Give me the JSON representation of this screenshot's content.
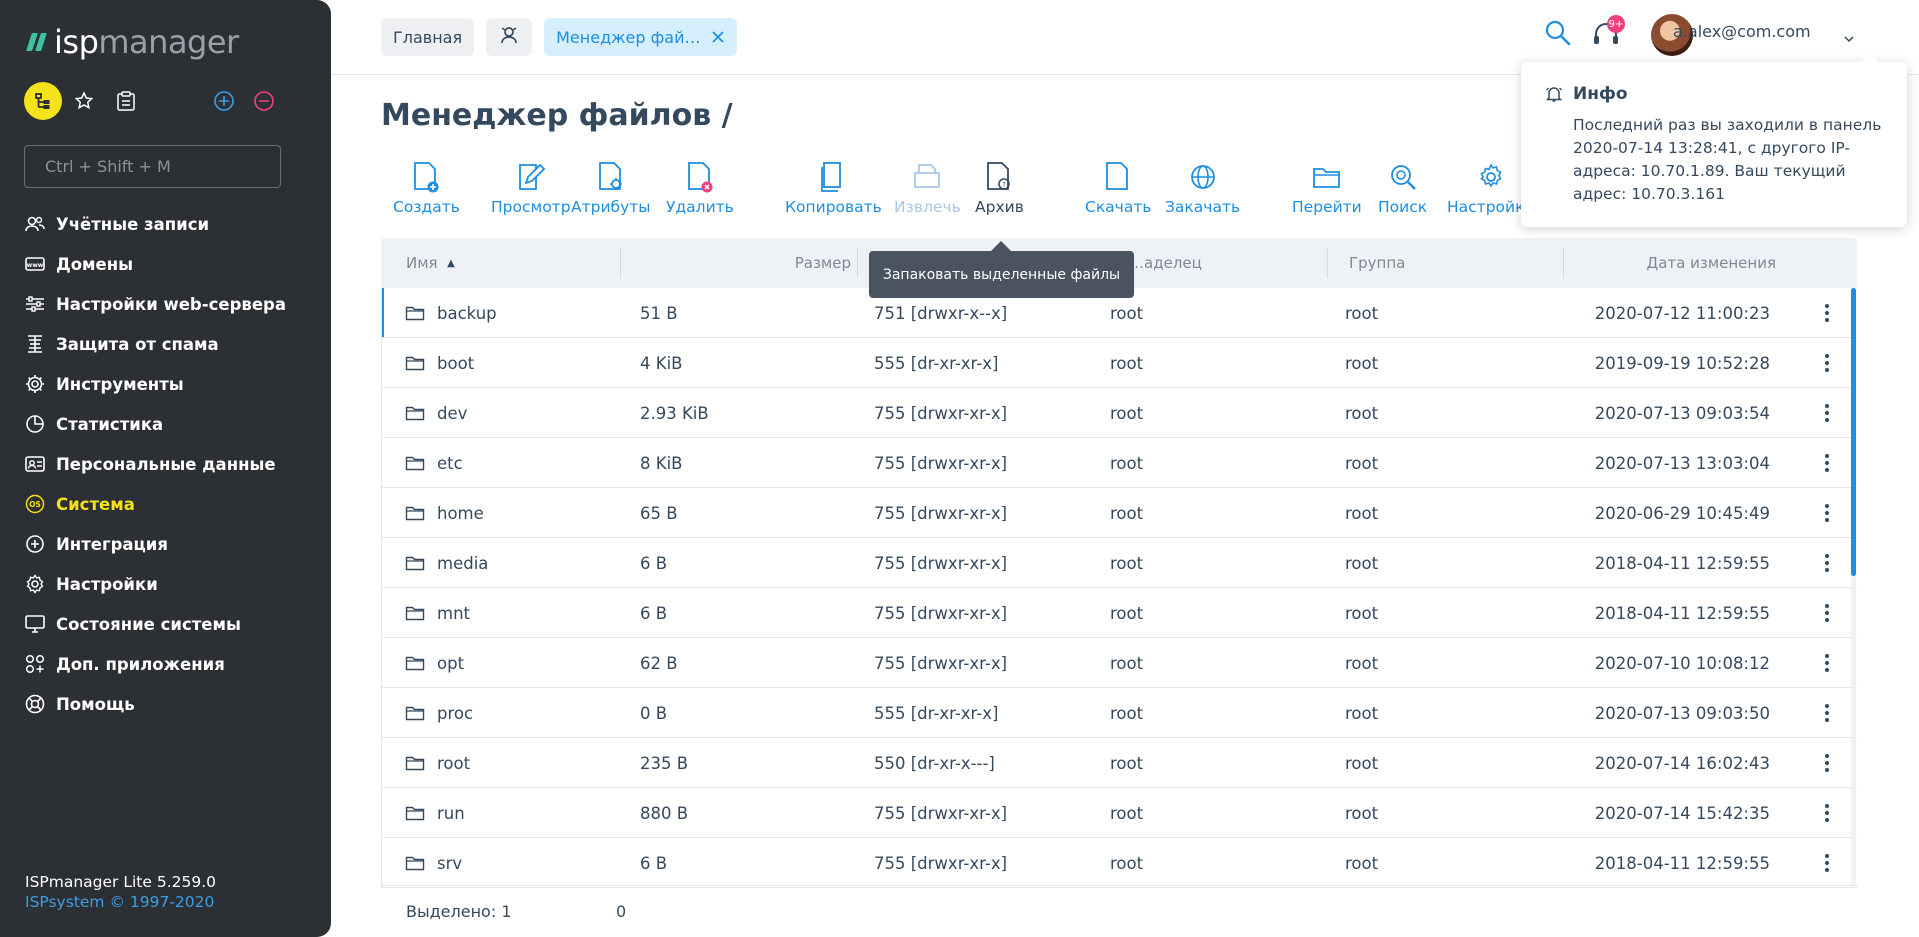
{
  "sidebar": {
    "logo_a": "isp",
    "logo_b": "manager",
    "search_placeholder": "Ctrl + Shift + M",
    "items": [
      {
        "label": "Учётные записи",
        "icon": "users-icon"
      },
      {
        "label": "Домены",
        "icon": "domains-icon"
      },
      {
        "label": "Настройки web-сервера",
        "icon": "sliders-icon"
      },
      {
        "label": "Защита от спама",
        "icon": "spam-shield-icon"
      },
      {
        "label": "Инструменты",
        "icon": "gear-icon"
      },
      {
        "label": "Статистика",
        "icon": "pie-chart-icon"
      },
      {
        "label": "Персональные данные",
        "icon": "personal-data-icon"
      },
      {
        "label": "Система",
        "icon": "os-icon"
      },
      {
        "label": "Интеграция",
        "icon": "integration-icon"
      },
      {
        "label": "Настройки",
        "icon": "settings-icon"
      },
      {
        "label": "Состояние системы",
        "icon": "monitor-icon"
      },
      {
        "label": "Доп. приложения",
        "icon": "apps-icon"
      },
      {
        "label": "Помощь",
        "icon": "lifebuoy-icon"
      }
    ],
    "active_index": 7,
    "version": "ISPmanager Lite 5.259.0",
    "copyright": "ISPsystem © 1997-2020"
  },
  "header": {
    "crumbs": [
      {
        "label": "Главная"
      },
      {
        "label": ""
      },
      {
        "label": "Менеджер фай…"
      }
    ],
    "notifications_badge": "9+",
    "user": "a.alex@com.com"
  },
  "page": {
    "title": "Менеджер файлов /"
  },
  "toolbar": [
    {
      "label": "Создать",
      "icon": "file-add-icon"
    },
    {
      "label": "Просмотр",
      "icon": "file-edit-icon"
    },
    {
      "label": "Атрибуты",
      "icon": "file-attributes-icon"
    },
    {
      "label": "Удалить",
      "icon": "file-delete-icon"
    },
    {
      "label": "Копировать",
      "icon": "copy-icon"
    },
    {
      "label": "Извлечь",
      "icon": "extract-icon"
    },
    {
      "label": "Архив",
      "icon": "archive-icon"
    },
    {
      "label": "Скачать",
      "icon": "download-icon"
    },
    {
      "label": "Закачать",
      "icon": "upload-globe-icon"
    },
    {
      "label": "Перейти",
      "icon": "folder-open-icon"
    },
    {
      "label": "Поиск",
      "icon": "search-icon"
    },
    {
      "label": "Настройки",
      "icon": "gear-icon"
    }
  ],
  "tooltip": "Запаковать выделенные файлы",
  "info": {
    "title": "Инфо",
    "text": "Последний раз вы заходили в панель 2020-07-14 13:28:41, с другого IP-адреса: 10.70.1.89. Ваш текущий адрес: 10.70.3.161"
  },
  "table": {
    "columns": [
      "Имя",
      "Размер",
      "…аделец",
      "Группа",
      "Дата изменения"
    ],
    "sort_indicator": "▲",
    "rows": [
      {
        "name": "backup",
        "size": "51 B",
        "perm": "751 [drwxr-x--x]",
        "owner": "root",
        "group": "root",
        "date": "2020-07-12 11:00:23"
      },
      {
        "name": "boot",
        "size": "4 KiB",
        "perm": "555 [dr-xr-xr-x]",
        "owner": "root",
        "group": "root",
        "date": "2019-09-19 10:52:28"
      },
      {
        "name": "dev",
        "size": "2.93 KiB",
        "perm": "755 [drwxr-xr-x]",
        "owner": "root",
        "group": "root",
        "date": "2020-07-13 09:03:54"
      },
      {
        "name": "etc",
        "size": "8 KiB",
        "perm": "755 [drwxr-xr-x]",
        "owner": "root",
        "group": "root",
        "date": "2020-07-13 13:03:04"
      },
      {
        "name": "home",
        "size": "65 B",
        "perm": "755 [drwxr-xr-x]",
        "owner": "root",
        "group": "root",
        "date": "2020-06-29 10:45:49"
      },
      {
        "name": "media",
        "size": "6 B",
        "perm": "755 [drwxr-xr-x]",
        "owner": "root",
        "group": "root",
        "date": "2018-04-11 12:59:55"
      },
      {
        "name": "mnt",
        "size": "6 B",
        "perm": "755 [drwxr-xr-x]",
        "owner": "root",
        "group": "root",
        "date": "2018-04-11 12:59:55"
      },
      {
        "name": "opt",
        "size": "62 B",
        "perm": "755 [drwxr-xr-x]",
        "owner": "root",
        "group": "root",
        "date": "2020-07-10 10:08:12"
      },
      {
        "name": "proc",
        "size": "0 B",
        "perm": "555 [dr-xr-xr-x]",
        "owner": "root",
        "group": "root",
        "date": "2020-07-13 09:03:50"
      },
      {
        "name": "root",
        "size": "235 B",
        "perm": "550 [dr-xr-x---]",
        "owner": "root",
        "group": "root",
        "date": "2020-07-14 16:02:43"
      },
      {
        "name": "run",
        "size": "880 B",
        "perm": "755 [drwxr-xr-x]",
        "owner": "root",
        "group": "root",
        "date": "2020-07-14 15:42:35"
      },
      {
        "name": "srv",
        "size": "6 B",
        "perm": "755 [drwxr-xr-x]",
        "owner": "root",
        "group": "root",
        "date": "2018-04-11 12:59:55"
      }
    ]
  },
  "status": {
    "selected_label": "Выделено: 1",
    "selected_value": "0"
  },
  "colors": {
    "accent": "#1d8ee0",
    "active_nav": "#f4e21a",
    "sidebar_bg": "#2c2f33",
    "badge": "#f0407c"
  }
}
